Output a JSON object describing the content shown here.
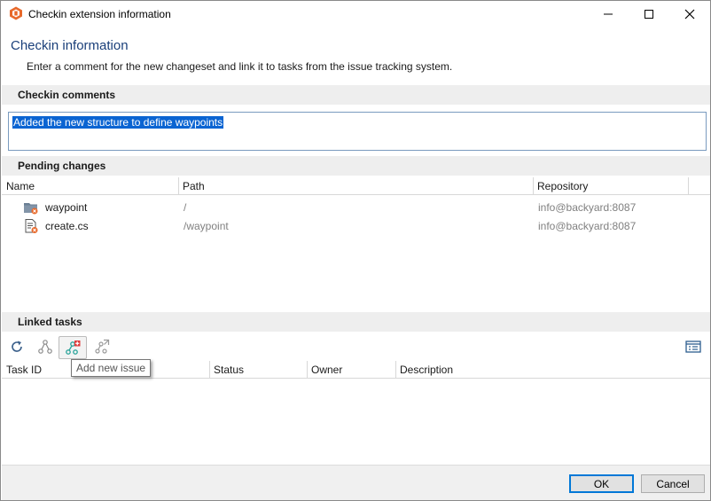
{
  "window": {
    "title": "Checkin extension information"
  },
  "header": {
    "title": "Checkin information",
    "subtitle": "Enter a comment for the new changeset and link it to tasks from the issue tracking system."
  },
  "comments": {
    "section_label": "Checkin comments",
    "value": "Added the new structure to define waypoints"
  },
  "pending": {
    "section_label": "Pending changes",
    "columns": [
      "Name",
      "Path",
      "Repository"
    ],
    "rows": [
      {
        "name": "waypoint",
        "path": "/",
        "repository": "info@backyard:8087",
        "icon": "folder-icon"
      },
      {
        "name": "create.cs",
        "path": "/waypoint",
        "repository": "info@backyard:8087",
        "icon": "file-icon"
      }
    ]
  },
  "tasks": {
    "section_label": "Linked tasks",
    "columns": [
      "Task ID",
      "Status",
      "Owner",
      "Description"
    ],
    "tooltip": "Add new issue"
  },
  "footer": {
    "ok_label": "OK",
    "cancel_label": "Cancel"
  },
  "colors": {
    "heading": "#1a3f7a",
    "selection": "#0a64d2",
    "accent_icon": "#e8692b"
  }
}
